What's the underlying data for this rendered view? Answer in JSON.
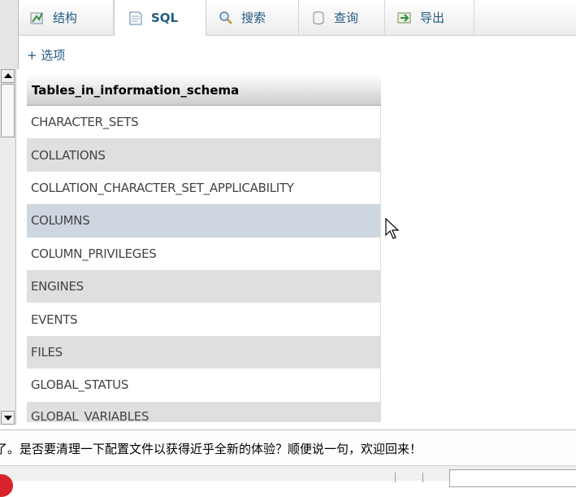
{
  "tabs": [
    {
      "label": "结构",
      "icon": "structure-icon"
    },
    {
      "label": "SQL",
      "icon": "sql-icon",
      "active": true
    },
    {
      "label": "搜索",
      "icon": "search-icon"
    },
    {
      "label": "查询",
      "icon": "query-icon"
    },
    {
      "label": "导出",
      "icon": "export-icon"
    }
  ],
  "options_link": "+ 选项",
  "table": {
    "header": "Tables_in_information_schema",
    "rows": [
      "CHARACTER_SETS",
      "COLLATIONS",
      "COLLATION_CHARACTER_SET_APPLICABILITY",
      "COLUMNS",
      "COLUMN_PRIVILEGES",
      "ENGINES",
      "EVENTS",
      "FILES",
      "GLOBAL_STATUS",
      "GLOBAL_VARIABLES"
    ],
    "hovered_row": "COLUMNS"
  },
  "notification": {
    "text": "了。是否要清理一下配置文件以获得近乎全新的体验？顺便说一句，欢迎回来！"
  },
  "colors": {
    "link": "#235a81",
    "row_even": "#dfdfdf",
    "row_hover": "#ced6df"
  }
}
